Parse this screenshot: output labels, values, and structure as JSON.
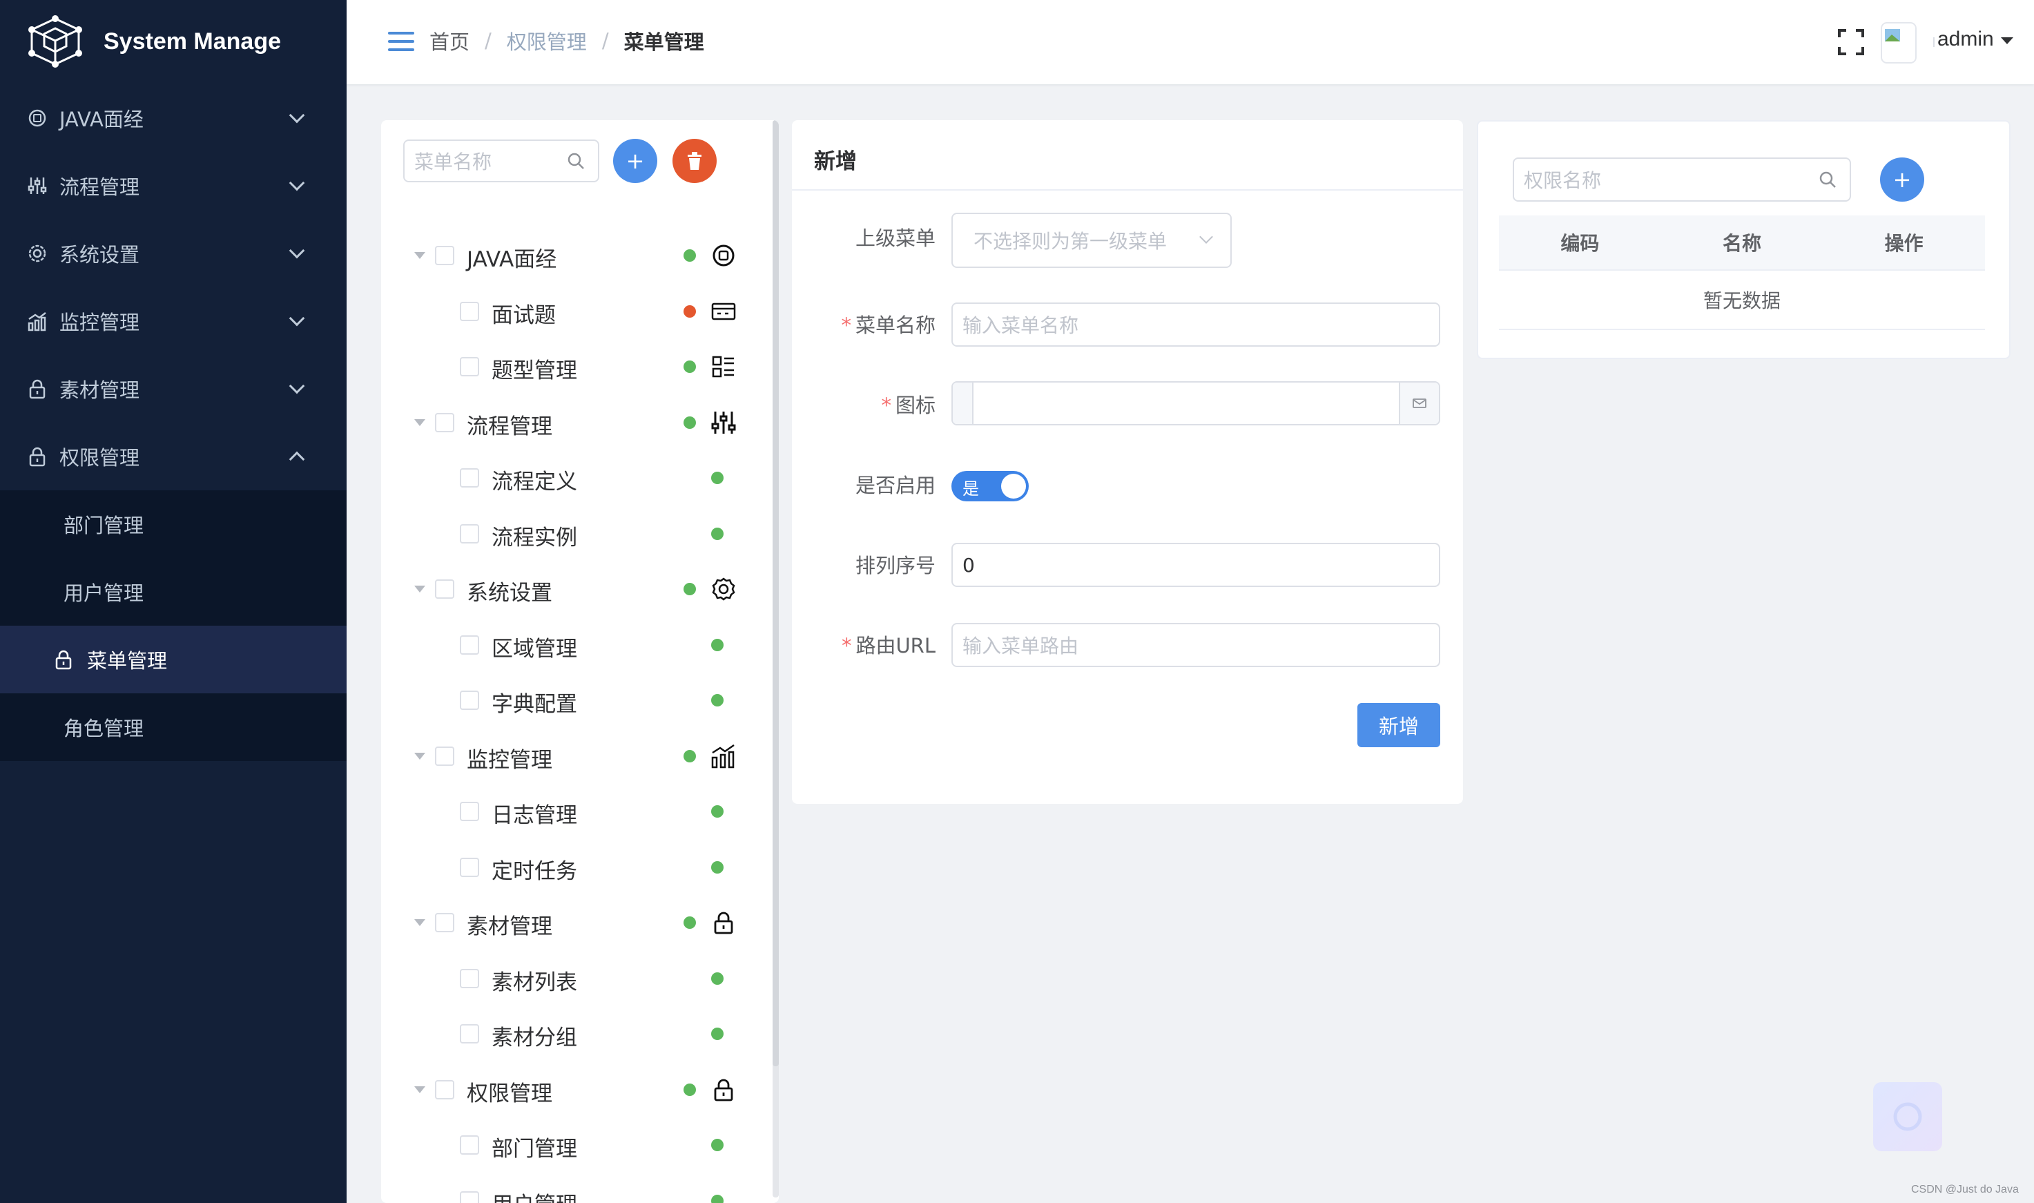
{
  "app": {
    "title": "System Manage"
  },
  "sidebar": {
    "items": [
      {
        "label": "JAVA面经",
        "icon": "badge-icon",
        "expanded": false
      },
      {
        "label": "流程管理",
        "icon": "sliders-icon",
        "expanded": false
      },
      {
        "label": "系统设置",
        "icon": "gear-icon",
        "expanded": false
      },
      {
        "label": "监控管理",
        "icon": "chart-icon",
        "expanded": false
      },
      {
        "label": "素材管理",
        "icon": "lock-icon",
        "expanded": false
      },
      {
        "label": "权限管理",
        "icon": "lock-icon",
        "expanded": true
      }
    ],
    "sub_items": [
      {
        "label": "部门管理",
        "active": false
      },
      {
        "label": "用户管理",
        "active": false
      },
      {
        "label": "菜单管理",
        "active": true
      },
      {
        "label": "角色管理",
        "active": false
      }
    ]
  },
  "header": {
    "breadcrumb": [
      "首页",
      "权限管理",
      "菜单管理"
    ],
    "user": "admin"
  },
  "tree_panel": {
    "search_placeholder": "菜单名称",
    "add_button": "+",
    "nodes": [
      {
        "label": "JAVA面经",
        "level": 1,
        "status": "green",
        "icon": "badge-icon"
      },
      {
        "label": "面试题",
        "level": 2,
        "status": "red",
        "icon": "ticket-icon"
      },
      {
        "label": "题型管理",
        "level": 2,
        "status": "green",
        "icon": "list-icon"
      },
      {
        "label": "流程管理",
        "level": 1,
        "status": "green",
        "icon": "sliders-icon"
      },
      {
        "label": "流程定义",
        "level": 2,
        "status": "green",
        "icon": ""
      },
      {
        "label": "流程实例",
        "level": 2,
        "status": "green",
        "icon": ""
      },
      {
        "label": "系统设置",
        "level": 1,
        "status": "green",
        "icon": "gear-icon"
      },
      {
        "label": "区域管理",
        "level": 2,
        "status": "green",
        "icon": ""
      },
      {
        "label": "字典配置",
        "level": 2,
        "status": "green",
        "icon": ""
      },
      {
        "label": "监控管理",
        "level": 1,
        "status": "green",
        "icon": "chart-icon"
      },
      {
        "label": "日志管理",
        "level": 2,
        "status": "green",
        "icon": ""
      },
      {
        "label": "定时任务",
        "level": 2,
        "status": "green",
        "icon": ""
      },
      {
        "label": "素材管理",
        "level": 1,
        "status": "green",
        "icon": "lock-icon"
      },
      {
        "label": "素材列表",
        "level": 2,
        "status": "green",
        "icon": ""
      },
      {
        "label": "素材分组",
        "level": 2,
        "status": "green",
        "icon": ""
      },
      {
        "label": "权限管理",
        "level": 1,
        "status": "green",
        "icon": "lock-icon"
      },
      {
        "label": "部门管理",
        "level": 2,
        "status": "green",
        "icon": ""
      },
      {
        "label": "用户管理",
        "level": 2,
        "status": "green",
        "icon": ""
      }
    ]
  },
  "form": {
    "title": "新增",
    "parent_label": "上级菜单",
    "parent_placeholder": "不选择则为第一级菜单",
    "name_label": "菜单名称",
    "name_placeholder": "输入菜单名称",
    "icon_label": "图标",
    "enabled_label": "是否启用",
    "enabled_value": "是",
    "order_label": "排列序号",
    "order_value": "0",
    "route_label": "路由URL",
    "route_placeholder": "输入菜单路由",
    "submit_label": "新增"
  },
  "permission_panel": {
    "search_placeholder": "权限名称",
    "add_button": "+",
    "columns": [
      "编码",
      "名称",
      "操作"
    ],
    "empty_text": "暂无数据"
  },
  "watermark": "CSDN @Just do Java",
  "colors": {
    "sidebar_bg": "#132038",
    "primary": "#4d8fe9",
    "danger": "#e4572e",
    "status_green": "#5cb85c",
    "status_red": "#e4572e"
  }
}
